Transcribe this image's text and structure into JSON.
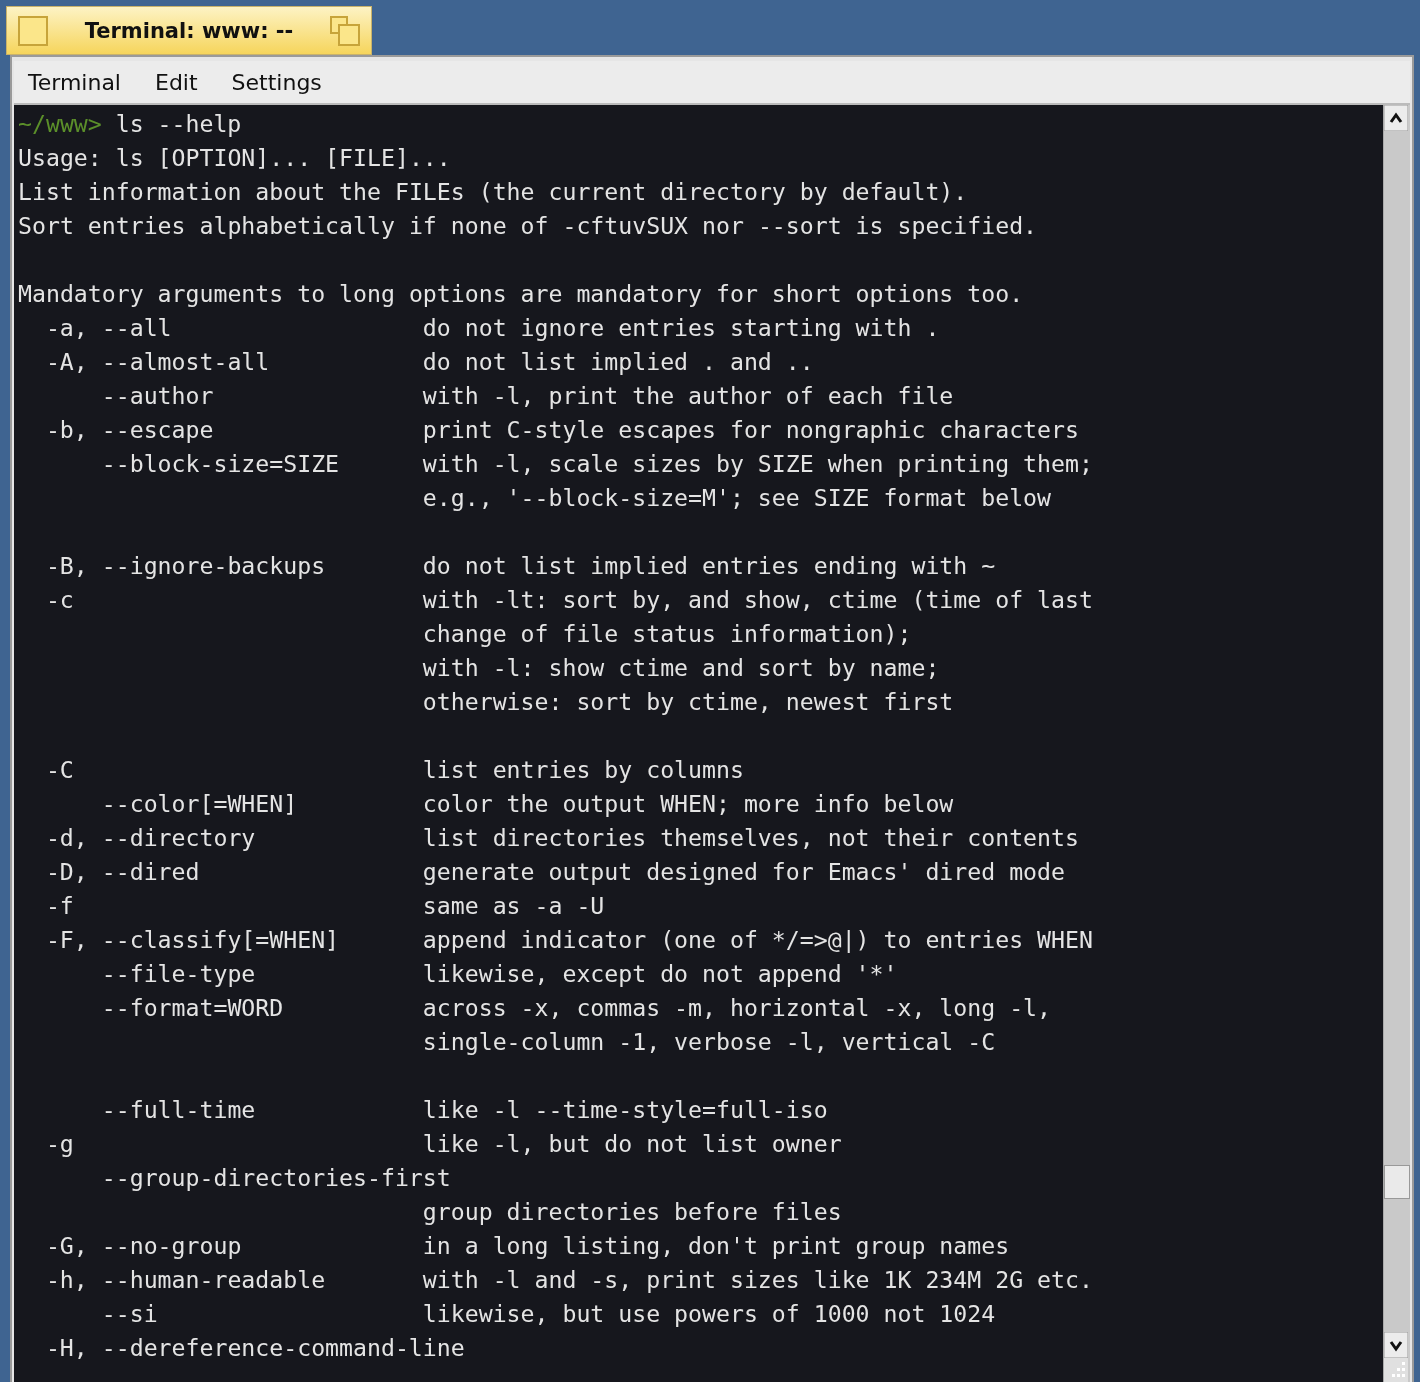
{
  "window": {
    "title": "Terminal: www: --"
  },
  "menu": [
    "Terminal",
    "Edit",
    "Settings"
  ],
  "terminal": {
    "lines": [
      {
        "kind": "prompt",
        "prompt": "~/www>",
        "text": "ls --help"
      },
      {
        "kind": "text",
        "text": "Usage: ls [OPTION]... [FILE]..."
      },
      {
        "kind": "text",
        "text": "List information about the FILEs (the current directory by default)."
      },
      {
        "kind": "text",
        "text": "Sort entries alphabetically if none of -cftuvSUX nor --sort is specified."
      },
      {
        "kind": "blank"
      },
      {
        "kind": "text",
        "text": "Mandatory arguments to long options are mandatory for short options too."
      },
      {
        "kind": "option",
        "option": "-a, --all",
        "description": "do not ignore entries starting with ."
      },
      {
        "kind": "option",
        "option": "-A, --almost-all",
        "description": "do not list implied . and .."
      },
      {
        "kind": "option",
        "option": "    --author",
        "description": "with -l, print the author of each file"
      },
      {
        "kind": "option",
        "option": "-b, --escape",
        "description": "print C-style escapes for nongraphic characters"
      },
      {
        "kind": "option",
        "option": "    --block-size=SIZE",
        "description": "with -l, scale sizes by SIZE when printing them;"
      },
      {
        "kind": "option",
        "description": "e.g., '--block-size=M'; see SIZE format below"
      },
      {
        "kind": "blank"
      },
      {
        "kind": "option",
        "option": "-B, --ignore-backups",
        "description": "do not list implied entries ending with ~"
      },
      {
        "kind": "option",
        "option": "-c",
        "description": "with -lt: sort by, and show, ctime (time of last"
      },
      {
        "kind": "option",
        "description": "change of file status information);"
      },
      {
        "kind": "option",
        "description": "with -l: show ctime and sort by name;"
      },
      {
        "kind": "option",
        "description": "otherwise: sort by ctime, newest first"
      },
      {
        "kind": "blank"
      },
      {
        "kind": "option",
        "option": "-C",
        "description": "list entries by columns"
      },
      {
        "kind": "option",
        "option": "    --color[=WHEN]",
        "description": "color the output WHEN; more info below"
      },
      {
        "kind": "option",
        "option": "-d, --directory",
        "description": "list directories themselves, not their contents"
      },
      {
        "kind": "option",
        "option": "-D, --dired",
        "description": "generate output designed for Emacs' dired mode"
      },
      {
        "kind": "option",
        "option": "-f",
        "description": "same as -a -U"
      },
      {
        "kind": "option",
        "option": "-F, --classify[=WHEN]",
        "description": "append indicator (one of */=>@|) to entries WHEN"
      },
      {
        "kind": "option",
        "option": "    --file-type",
        "description": "likewise, except do not append '*'"
      },
      {
        "kind": "option",
        "option": "    --format=WORD",
        "description": "across -x, commas -m, horizontal -x, long -l,"
      },
      {
        "kind": "option",
        "description": "single-column -1, verbose -l, vertical -C"
      },
      {
        "kind": "blank"
      },
      {
        "kind": "option",
        "option": "    --full-time",
        "description": "like -l --time-style=full-iso"
      },
      {
        "kind": "option",
        "option": "-g",
        "description": "like -l, but do not list owner"
      },
      {
        "kind": "option",
        "option": "    --group-directories-first"
      },
      {
        "kind": "option",
        "description": "group directories before files"
      },
      {
        "kind": "option",
        "option": "-G, --no-group",
        "description": "in a long listing, don't print group names"
      },
      {
        "kind": "option",
        "option": "-h, --human-readable",
        "description": "with -l and -s, print sizes like 1K 234M 2G etc."
      },
      {
        "kind": "option",
        "option": "    --si",
        "description": "likewise, but use powers of 1000 not 1024"
      },
      {
        "kind": "option",
        "option": "-H, --dereference-command-line"
      }
    ]
  }
}
